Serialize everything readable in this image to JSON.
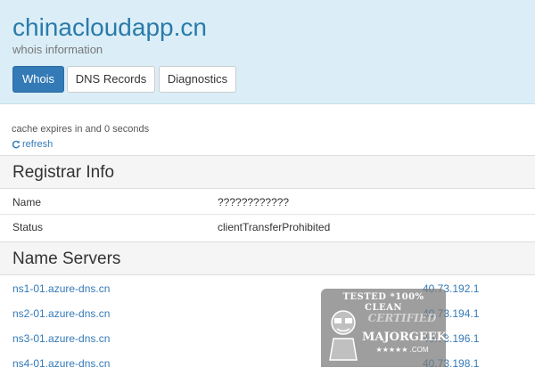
{
  "header": {
    "domain": "chinacloudapp.cn",
    "subtitle": "whois information",
    "tabs": [
      {
        "label": "Whois",
        "active": true
      },
      {
        "label": "DNS Records",
        "active": false
      },
      {
        "label": "Diagnostics",
        "active": false
      }
    ]
  },
  "cache": {
    "text": "cache expires in and 0 seconds",
    "refresh_label": "refresh"
  },
  "registrar": {
    "title": "Registrar Info",
    "rows": [
      {
        "key": "Name",
        "value": "????????????"
      },
      {
        "key": "Status",
        "value": "clientTransferProhibited"
      }
    ]
  },
  "nameservers": {
    "title": "Name Servers",
    "rows": [
      {
        "host": "ns1-01.azure-dns.cn",
        "ip": "40.73.192.1"
      },
      {
        "host": "ns2-01.azure-dns.cn",
        "ip": "40.73.194.1"
      },
      {
        "host": "ns3-01.azure-dns.cn",
        "ip": "40.73.196.1"
      },
      {
        "host": "ns4-01.azure-dns.cn",
        "ip": "40.73.198.1"
      }
    ]
  },
  "watermark": {
    "line1": "TESTED *100% CLEAN",
    "line2": "CERTIFIED",
    "line3": "MAJORGEEKS",
    "line4": "★★★★★ .COM"
  },
  "colors": {
    "header_bg": "#dbeef8",
    "accent": "#337ab7",
    "domain_text": "#2a7ba9"
  }
}
